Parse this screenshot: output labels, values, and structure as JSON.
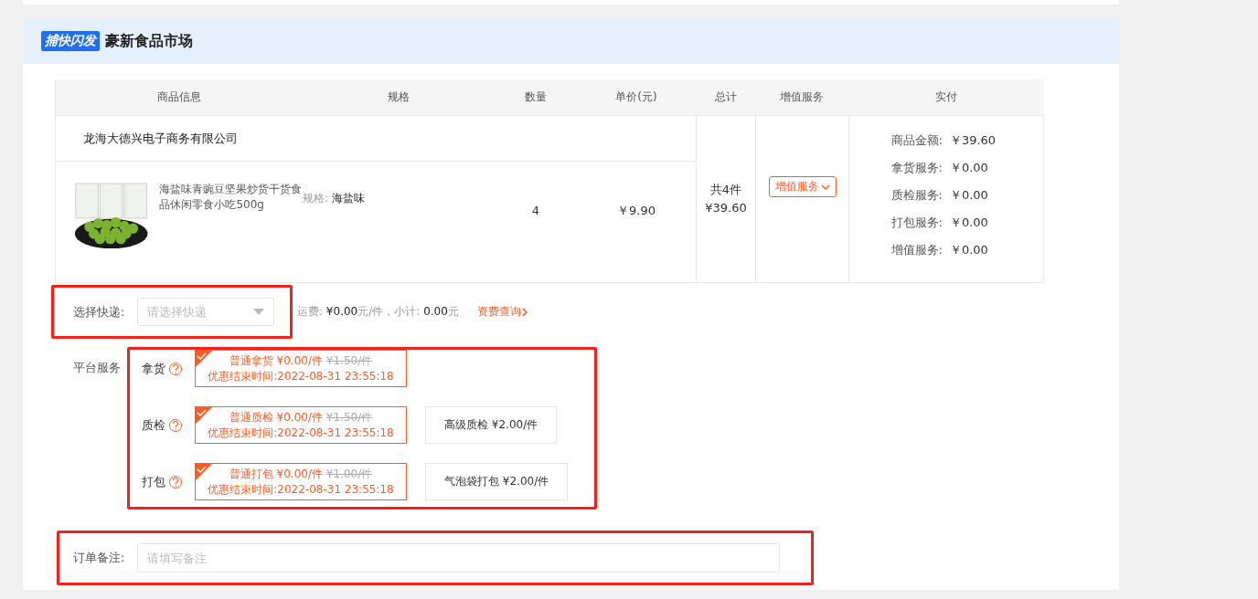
{
  "store": {
    "logo_text": "捕快闪发",
    "name": "豪新食品市场"
  },
  "table": {
    "columns": [
      "商品信息",
      "规格",
      "数量",
      "单价(元)",
      "总计",
      "增值服务",
      "实付"
    ],
    "shop": "龙海大德兴电子商务有限公司",
    "item": {
      "title": "海盐味青豌豆坚果炒货干货食品休闲零食小吃500g",
      "spec_label": "规格:",
      "spec_value": "海盐味",
      "quantity": "4",
      "price": "￥9.90"
    },
    "total": [
      "共4件",
      "¥39.60"
    ],
    "service_button": "增值服务",
    "payment": [
      {
        "label": "商品金额:",
        "amount": "￥39.60"
      },
      {
        "label": "拿货服务:",
        "amount": "￥0.00"
      },
      {
        "label": "质检服务:",
        "amount": "￥0.00"
      },
      {
        "label": "打包服务:",
        "amount": "￥0.00"
      },
      {
        "label": "增值服务:",
        "amount": "￥0.00"
      }
    ]
  },
  "express": {
    "label": "选择快递:",
    "placeholder": "请选择快递",
    "fee": [
      {
        "kind": "label",
        "text": "运费: "
      },
      {
        "kind": "value",
        "text": "¥0.00"
      },
      {
        "kind": "label",
        "text": "元/件，小计: "
      },
      {
        "kind": "value",
        "text": "0.00"
      },
      {
        "kind": "label",
        "text": "元"
      }
    ],
    "link": "资费查询"
  },
  "platform": {
    "label": "平台服务",
    "services": [
      {
        "name": "拿货",
        "options": [
          {
            "kind": "promo",
            "selected": true,
            "title": "普通拿货 ¥0.00/件",
            "old_price": "¥1.50/件",
            "note": "优惠结束时间:2022-08-31 23:55:18"
          }
        ]
      },
      {
        "name": "质检",
        "options": [
          {
            "kind": "promo",
            "selected": true,
            "title": "普通质检 ¥0.00/件",
            "old_price": "¥1.50/件",
            "note": "优惠结束时间:2022-08-31 23:55:18"
          },
          {
            "kind": "plain",
            "selected": false,
            "title": "高级质检 ¥2.00/件"
          }
        ]
      },
      {
        "name": "打包",
        "options": [
          {
            "kind": "promo",
            "selected": true,
            "title": "普通打包 ¥0.00/件",
            "old_price": "¥1.00/件",
            "note": "优惠结束时间:2022-08-31 23:55:18"
          },
          {
            "kind": "plain",
            "selected": false,
            "title": "气泡袋打包 ¥2.00/件"
          }
        ]
      }
    ]
  },
  "remark": {
    "label": "订单备注:",
    "placeholder": "请填写备注"
  }
}
